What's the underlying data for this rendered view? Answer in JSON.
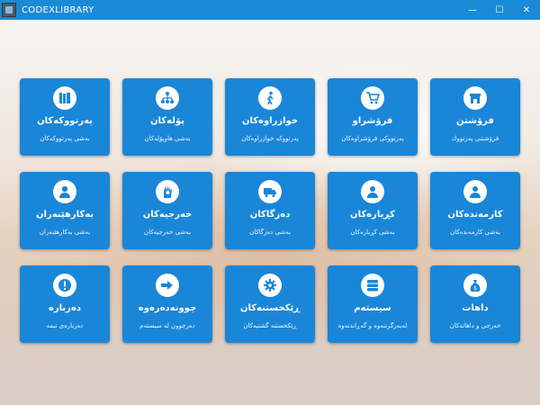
{
  "window": {
    "title": "CODEXLIBRARY",
    "minimize": "—",
    "maximize": "☐",
    "close": "✕"
  },
  "tiles": [
    {
      "title": "فرۆشتن",
      "subtitle": "فرۆشتنی پەرتووك",
      "icon": "store-icon"
    },
    {
      "title": "فرۆشراو",
      "subtitle": "پەرتووکی فرۆشراوەکان",
      "icon": "cart-icon"
    },
    {
      "title": "خوازراوەکان",
      "subtitle": "پەرتووکە خوازراوەکان",
      "icon": "walking-person-icon"
    },
    {
      "title": "پۆلەکان",
      "subtitle": "بەشی هاوپۆلەکان",
      "icon": "hierarchy-icon"
    },
    {
      "title": "پەرتووکەکان",
      "subtitle": "بەشی پەرتووکەکان",
      "icon": "books-icon"
    },
    {
      "title": "کارمەندەکان",
      "subtitle": "بەشی کارمەندەکان",
      "icon": "employee-icon"
    },
    {
      "title": "کڕیارەکان",
      "subtitle": "بەشی کڕیارەکان",
      "icon": "customer-icon"
    },
    {
      "title": "دەزگاکان",
      "subtitle": "بەشی دەزگاکان",
      "icon": "truck-icon"
    },
    {
      "title": "خەرجیەکان",
      "subtitle": "بەشی خەرجیەکان",
      "icon": "hand-money-icon"
    },
    {
      "title": "بەکارهێنەران",
      "subtitle": "بەشی بەکارهێنەران",
      "icon": "user-icon"
    },
    {
      "title": "داهات",
      "subtitle": "خەرجی و داهاتەکان",
      "icon": "money-bag-icon"
    },
    {
      "title": "سیستەم",
      "subtitle": "لەبەرگرتنەوە و گەڕاندنەوە",
      "icon": "database-icon"
    },
    {
      "title": "ڕێکخستنەکان",
      "subtitle": "ڕێکخستنە گشتیەکان",
      "icon": "gear-icon"
    },
    {
      "title": "چوونەدەرەوە",
      "subtitle": "دەرچوون لە سیستەم",
      "icon": "logout-arrow-icon"
    },
    {
      "title": "دەربارە",
      "subtitle": "دەربارەی تیمە",
      "icon": "info-icon"
    }
  ],
  "colors": {
    "titlebar": "#1b8ad6",
    "tile": "#1a86d8",
    "text": "#ffffff"
  }
}
